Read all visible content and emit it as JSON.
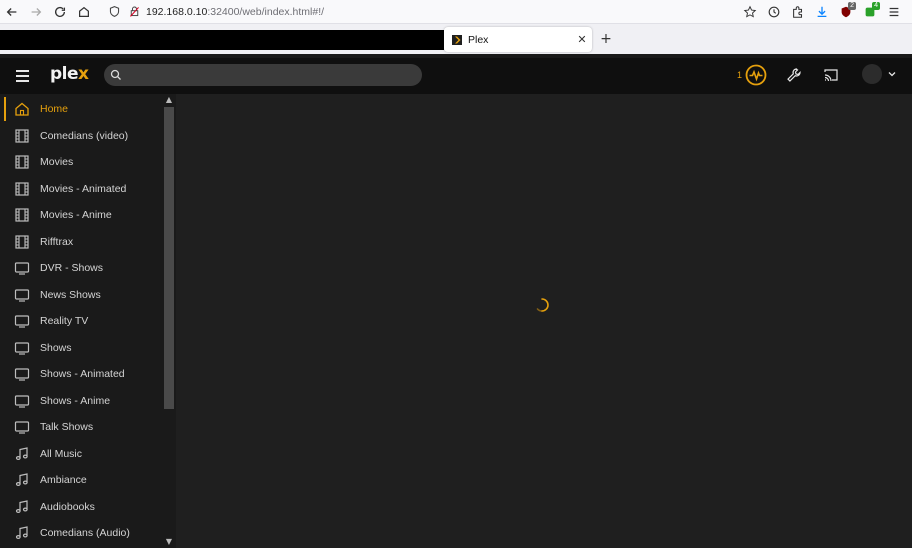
{
  "browser": {
    "url_host": "192.168.0.10",
    "url_rest": ":32400/web/index.html#!/",
    "tab_title": "Plex",
    "tab_close": "✕",
    "new_tab": "+",
    "badges": {
      "ublock": "2",
      "ext": "4"
    }
  },
  "header": {
    "logo_main": "ple",
    "logo_accent": "x",
    "search_placeholder": "",
    "activity_count": "1"
  },
  "sidebar": {
    "items": [
      {
        "label": "Home",
        "icon": "home",
        "active": true
      },
      {
        "label": "Comedians (video)",
        "icon": "film"
      },
      {
        "label": "Movies",
        "icon": "film"
      },
      {
        "label": "Movies - Animated",
        "icon": "film"
      },
      {
        "label": "Movies - Anime",
        "icon": "film"
      },
      {
        "label": "Rifftrax",
        "icon": "film"
      },
      {
        "label": "DVR - Shows",
        "icon": "tv"
      },
      {
        "label": "News Shows",
        "icon": "tv"
      },
      {
        "label": "Reality TV",
        "icon": "tv"
      },
      {
        "label": "Shows",
        "icon": "tv"
      },
      {
        "label": "Shows - Animated",
        "icon": "tv"
      },
      {
        "label": "Shows - Anime",
        "icon": "tv"
      },
      {
        "label": "Talk Shows",
        "icon": "tv"
      },
      {
        "label": "All Music",
        "icon": "music"
      },
      {
        "label": "Ambiance",
        "icon": "music"
      },
      {
        "label": "Audiobooks",
        "icon": "music"
      },
      {
        "label": "Comedians (Audio)",
        "icon": "music"
      }
    ]
  },
  "colors": {
    "accent": "#e5a00d",
    "sidebar_bg": "#1a1a1a",
    "main_bg": "#1f1f1f",
    "header_bg": "#0f0f0f"
  }
}
